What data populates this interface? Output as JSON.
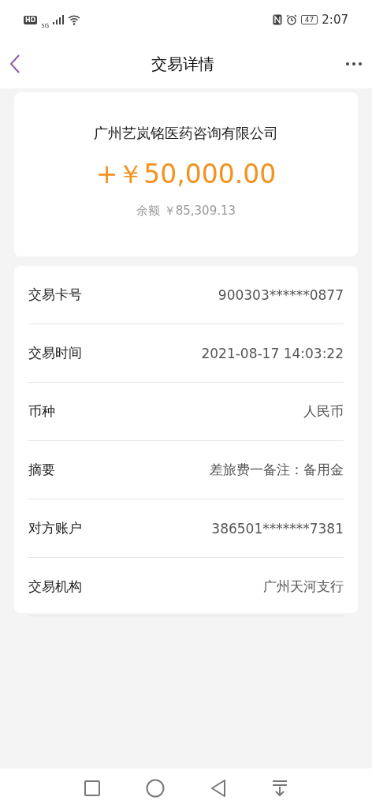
{
  "status_bar": {
    "hd": "HD",
    "network": "5G",
    "battery": "47",
    "time": "2:07"
  },
  "header": {
    "title": "交易详情"
  },
  "summary": {
    "counterparty": "广州艺岚铭医药咨询有限公司",
    "amount": "+￥50,000.00",
    "balance_label": "余额",
    "balance": "￥85,309.13"
  },
  "details": [
    {
      "label": "交易卡号",
      "value": "900303******0877"
    },
    {
      "label": "交易时间",
      "value": "2021-08-17 14:03:22"
    },
    {
      "label": "币种",
      "value": "人民币"
    },
    {
      "label": "摘要",
      "value": "差旅费一备注：备用金"
    },
    {
      "label": "对方账户",
      "value": "386501*******7381"
    },
    {
      "label": "交易机构",
      "value": "广州天河支行"
    }
  ]
}
